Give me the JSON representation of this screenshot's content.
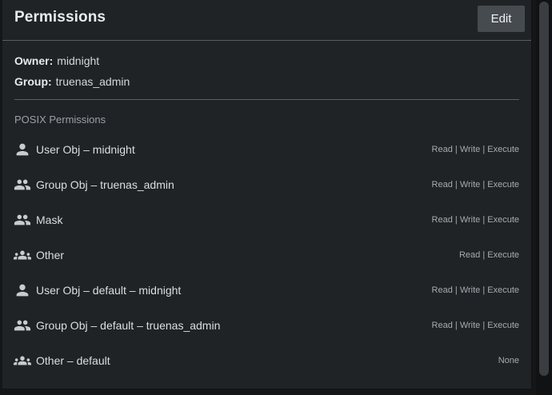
{
  "header": {
    "title": "Permissions",
    "edit_label": "Edit"
  },
  "owner": {
    "owner_label": "Owner:",
    "owner_value": "midnight",
    "group_label": "Group:",
    "group_value": "truenas_admin"
  },
  "posix": {
    "section_title": "POSIX Permissions",
    "items": [
      {
        "icon": "person-icon",
        "label": "User Obj – midnight",
        "value": "Read | Write | Execute"
      },
      {
        "icon": "group-icon",
        "label": "Group Obj – truenas_admin",
        "value": "Read | Write | Execute"
      },
      {
        "icon": "group-icon",
        "label": "Mask",
        "value": "Read | Write | Execute"
      },
      {
        "icon": "groups-icon",
        "label": "Other",
        "value": "Read | Execute"
      },
      {
        "icon": "person-icon",
        "label": "User Obj – default – midnight",
        "value": "Read | Write | Execute"
      },
      {
        "icon": "group-icon",
        "label": "Group Obj – default – truenas_admin",
        "value": "Read | Write | Execute"
      },
      {
        "icon": "groups-icon",
        "label": "Other – default",
        "value": "None"
      }
    ]
  },
  "colors": {
    "background": "#1f2326",
    "button": "#464b50",
    "text": "#dcdee0",
    "muted": "#a7abaf"
  }
}
